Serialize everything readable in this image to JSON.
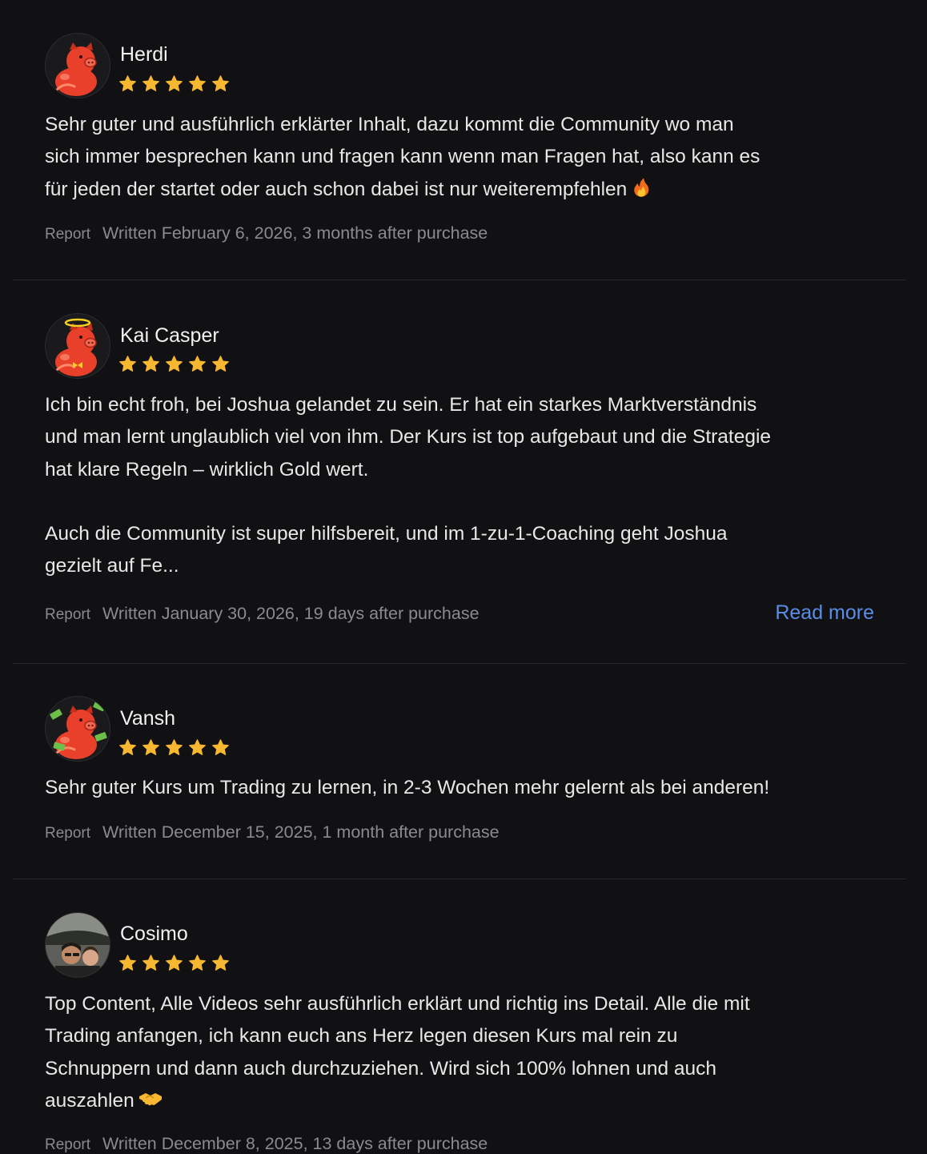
{
  "colors": {
    "background": "#111113",
    "star": "#f7b731",
    "link": "#5a8ee6",
    "muted": "#8a8a90",
    "avatar_red": "#e8402a"
  },
  "reviews": [
    {
      "name": "Herdi",
      "rating": 5,
      "avatar_icon": "red-pig-avatar-icon",
      "body": "Sehr guter und ausführlich erklärter Inhalt, dazu kommt die Community wo man\nsich immer besprechen kann und fragen kann wenn man Fragen hat, also kann es\nfür jeden der startet oder auch schon dabei ist nur weiterempfehlen",
      "trailing_emoji": "fire-emoji-icon",
      "report_label": "Report",
      "written": "Written February 6, 2026, 3 months after purchase"
    },
    {
      "name": "Kai Casper",
      "rating": 5,
      "avatar_icon": "red-pig-halo-avatar-icon",
      "body": "Ich bin echt froh, bei Joshua gelandet zu sein. Er hat ein starkes Marktverständnis\nund man lernt unglaublich viel von ihm. Der Kurs ist top aufgebaut und die Strategie\nhat klare Regeln – wirklich Gold wert.\n\nAuch die Community ist super hilfsbereit, und im 1-zu-1-Coaching geht Joshua\ngezielt auf Fe...",
      "report_label": "Report",
      "written": "Written January 30, 2026, 19 days after purchase",
      "read_more_label": "Read more"
    },
    {
      "name": "Vansh",
      "rating": 5,
      "avatar_icon": "red-pig-money-avatar-icon",
      "body": "Sehr guter Kurs um Trading zu lernen, in 2-3 Wochen mehr gelernt als bei anderen!",
      "report_label": "Report",
      "written": "Written December 15, 2025, 1 month after purchase"
    },
    {
      "name": "Cosimo",
      "rating": 5,
      "avatar_icon": "photo-avatar-icon",
      "body": "Top Content, Alle Videos sehr ausführlich erklärt und richtig ins Detail. Alle die mit\nTrading anfangen, ich kann euch ans Herz legen diesen Kurs mal rein zu\nSchnuppern und dann auch durchzuziehen. Wird sich 100% lohnen und auch\nauszahlen",
      "trailing_emoji": "handshake-emoji-icon",
      "report_label": "Report",
      "written": "Written December 8, 2025, 13 days after purchase"
    }
  ]
}
